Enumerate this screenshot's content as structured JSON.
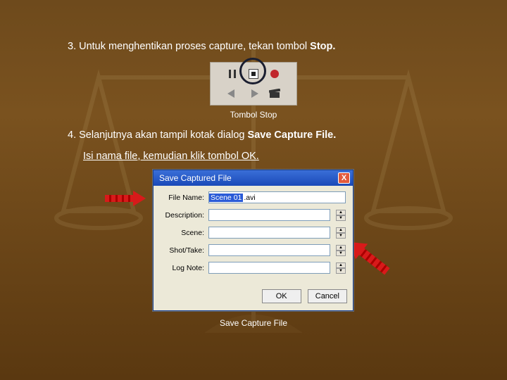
{
  "step3": {
    "prefix": "3. Untuk menghentikan proses capture, tekan tombol ",
    "bold": "Stop."
  },
  "fig1": {
    "caption": "Tombol Stop"
  },
  "step4": {
    "line1_prefix": "4. Selanjutnya akan tampil kotak dialog ",
    "line1_bold": "Save Capture File.",
    "line2": "Isi nama file, kemudian klik tombol OK."
  },
  "dialog": {
    "title": "Save Captured File",
    "close": "X",
    "labels": {
      "filename": "File Name:",
      "description": "Description:",
      "scene": "Scene:",
      "shot": "Shot/Take:",
      "lognote": "Log Note:"
    },
    "values": {
      "filename_sel": "Scene 01",
      "filename_ext": ".avi"
    },
    "buttons": {
      "ok": "OK",
      "cancel": "Cancel"
    }
  },
  "fig2": {
    "caption": "Save Capture File"
  }
}
